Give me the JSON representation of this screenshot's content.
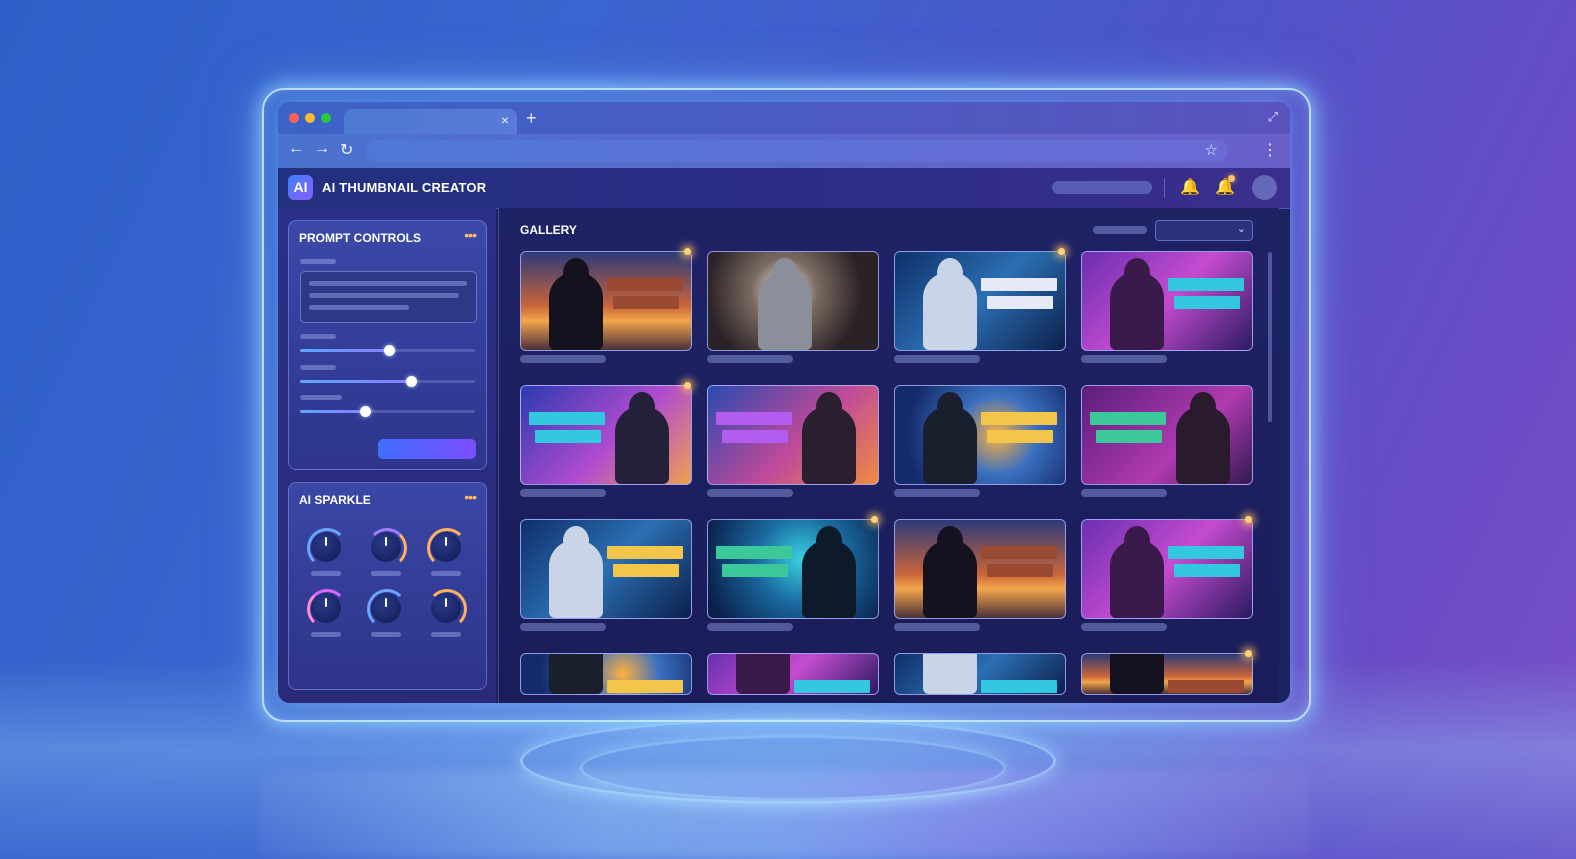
{
  "app": {
    "title": "AI THUMBNAIL CREATOR",
    "logo_text": "AI"
  },
  "browser": {
    "tab_close": "×",
    "new_tab": "+",
    "back": "←",
    "forward": "→",
    "reload": "↻",
    "bookmark": "☆",
    "menu": "⋮",
    "fullscreen": "⤢"
  },
  "header_icons": {
    "bell": "🔔",
    "bell2": "🔔"
  },
  "sidebar": {
    "prompt_controls": {
      "title": "PROMPT CONTROLS",
      "more": "•••",
      "sliders": [
        0.5,
        0.63,
        0.37
      ]
    },
    "ai_sparkle": {
      "title": "AI SPARKLE",
      "more": "•••"
    }
  },
  "gallery": {
    "title": "GALLERY",
    "sort_chevron": "⌄"
  },
  "colors": {
    "accent": "#7c4dff",
    "orange_bar": "#9a4a32",
    "cyan_bar": "#33c7e0",
    "yellow_bar": "#f2c64a",
    "green_bar": "#3cc89a",
    "purple_bar": "#b35cf0",
    "spark": "#ffc46b"
  },
  "thumbnails": [
    {
      "subject": "hiker-sunset",
      "bar_color": "#9a4a32"
    },
    {
      "subject": "cooking-pot",
      "bar_color": ""
    },
    {
      "subject": "robot",
      "bar_color": "#e6eaf6"
    },
    {
      "subject": "woman-headphones",
      "bar_color": "#33c7e0"
    },
    {
      "subject": "man-headphones",
      "bar_color": "#33c7e0"
    },
    {
      "subject": "man-sunglasses",
      "bar_color": "#b35cf0"
    },
    {
      "subject": "astronaut",
      "bar_color": "#f2c64a"
    },
    {
      "subject": "man-glasses-headphones",
      "bar_color": "#3cc89a"
    },
    {
      "subject": "robot",
      "bar_color": "#f2c64a"
    },
    {
      "subject": "hooded-figure",
      "bar_color": "#3cc89a"
    },
    {
      "subject": "hiker-sunset",
      "bar_color": "#9a4a32"
    },
    {
      "subject": "woman-headphones",
      "bar_color": "#33c7e0"
    },
    {
      "subject": "astronaut",
      "bar_color": "#f2c64a"
    },
    {
      "subject": "woman-headphones",
      "bar_color": "#33c7e0"
    },
    {
      "subject": "robot",
      "bar_color": "#33c7e0"
    },
    {
      "subject": "hiker-sunset",
      "bar_color": "#9a4a32"
    }
  ]
}
